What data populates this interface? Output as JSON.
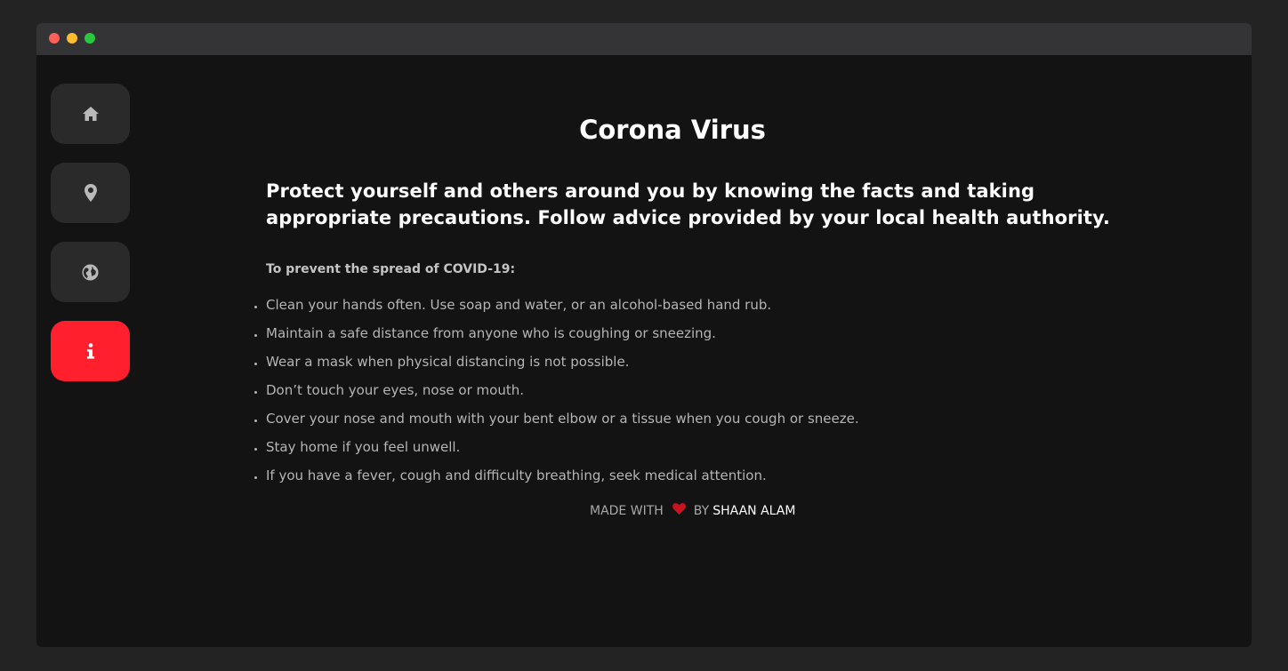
{
  "window": {
    "controls": [
      "close",
      "minimize",
      "maximize"
    ]
  },
  "nav": {
    "items": [
      {
        "icon": "home-icon",
        "active": false
      },
      {
        "icon": "map-marker-icon",
        "active": false
      },
      {
        "icon": "globe-icon",
        "active": false
      },
      {
        "icon": "info-icon",
        "active": true
      }
    ],
    "active_color": "#ff1f2d"
  },
  "main": {
    "title": "Corona Virus",
    "lead": "Protect yourself and others around you by knowing the facts and taking appropriate precautions. Follow advice provided by your local health authority.",
    "subhead": "To prevent the spread of COVID-19:",
    "tips": [
      "Clean your hands often. Use soap and water, or an alcohol-based hand rub.",
      "Maintain a safe distance from anyone who is coughing or sneezing.",
      "Wear a mask when physical distancing is not possible.",
      "Don’t touch your eyes, nose or mouth.",
      "Cover your nose and mouth with your bent elbow or a tissue when you cough or sneeze.",
      "Stay home if you feel unwell.",
      "If you have a fever, cough and difficulty breathing, seek medical attention."
    ]
  },
  "footer": {
    "made_with": "MADE WITH",
    "heart_icon": "heart-icon",
    "by": "BY",
    "author": "SHAAN ALAM"
  }
}
